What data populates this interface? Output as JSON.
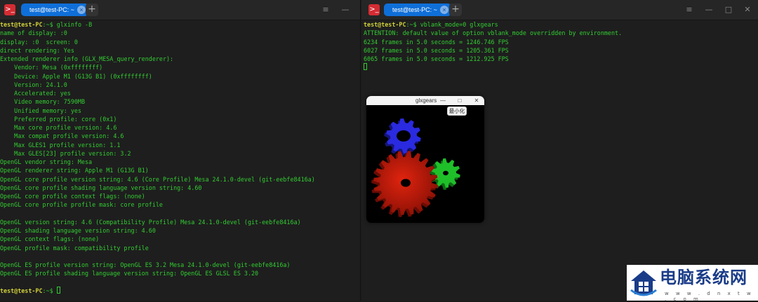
{
  "left_terminal": {
    "tab_title": "test@test-PC: ~",
    "lines": [
      {
        "user": "test@test-PC",
        "path": ":~$ ",
        "cmd": "glxinfo -B"
      },
      {
        "text": "name of display: :0"
      },
      {
        "text": "display: :0  screen: 0"
      },
      {
        "text": "direct rendering: Yes"
      },
      {
        "text": "Extended renderer info (GLX_MESA_query_renderer):"
      },
      {
        "text": "    Vendor: Mesa (0xffffffff)"
      },
      {
        "text": "    Device: Apple M1 (G13G B1) (0xffffffff)"
      },
      {
        "text": "    Version: 24.1.0"
      },
      {
        "text": "    Accelerated: yes"
      },
      {
        "text": "    Video memory: 7590MB"
      },
      {
        "text": "    Unified memory: yes"
      },
      {
        "text": "    Preferred profile: core (0x1)"
      },
      {
        "text": "    Max core profile version: 4.6"
      },
      {
        "text": "    Max compat profile version: 4.6"
      },
      {
        "text": "    Max GLES1 profile version: 1.1"
      },
      {
        "text": "    Max GLES[23] profile version: 3.2"
      },
      {
        "text": "OpenGL vendor string: Mesa"
      },
      {
        "text": "OpenGL renderer string: Apple M1 (G13G B1)"
      },
      {
        "text": "OpenGL core profile version string: 4.6 (Core Profile) Mesa 24.1.0-devel (git-eebfe8416a)"
      },
      {
        "text": "OpenGL core profile shading language version string: 4.60"
      },
      {
        "text": "OpenGL core profile context flags: (none)"
      },
      {
        "text": "OpenGL core profile profile mask: core profile"
      },
      {
        "text": ""
      },
      {
        "text": "OpenGL version string: 4.6 (Compatibility Profile) Mesa 24.1.0-devel (git-eebfe8416a)"
      },
      {
        "text": "OpenGL shading language version string: 4.60"
      },
      {
        "text": "OpenGL context flags: (none)"
      },
      {
        "text": "OpenGL profile mask: compatibility profile"
      },
      {
        "text": ""
      },
      {
        "text": "OpenGL ES profile version string: OpenGL ES 3.2 Mesa 24.1.0-devel (git-eebfe8416a)"
      },
      {
        "text": "OpenGL ES profile shading language version string: OpenGL ES GLSL ES 3.20"
      },
      {
        "text": ""
      },
      {
        "user": "test@test-PC",
        "path": ":~$ ",
        "cmd": "",
        "cursor": true
      }
    ]
  },
  "right_terminal": {
    "tab_title": "test@test-PC: ~",
    "lines": [
      {
        "user": "test@test-PC",
        "path": ":~$ ",
        "cmd": "vblank_mode=0 glxgears"
      },
      {
        "text": "ATTENTION: default value of option vblank_mode overridden by environment."
      },
      {
        "text": "6234 frames in 5.0 seconds = 1246.746 FPS"
      },
      {
        "text": "6027 frames in 5.0 seconds = 1205.361 FPS"
      },
      {
        "text": "6065 frames in 5.0 seconds = 1212.925 FPS"
      },
      {
        "text": "",
        "cursor": true
      }
    ]
  },
  "glxgears": {
    "title": "glxgears",
    "tooltip": "最小化",
    "gear_colors": {
      "red": "#cc1a0a",
      "green": "#1fbf2a",
      "blue": "#2a2ae0"
    }
  },
  "watermark": {
    "title": "电脑系统网",
    "url": "w w w . d n x t w . c o m"
  },
  "colors": {
    "terminal_bg": "#1e1e1e",
    "text_green": "#33cc33",
    "prompt_yellow": "#cfcf3a",
    "tab_blue": "#0f6fd8"
  }
}
